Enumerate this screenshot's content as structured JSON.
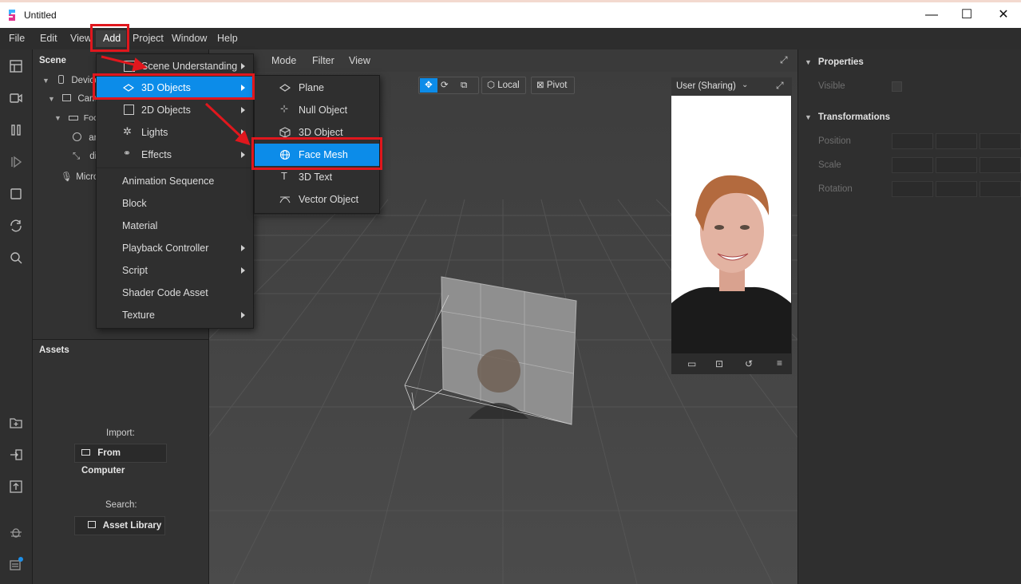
{
  "window": {
    "title": "Untitled",
    "minimize": "—",
    "maximize": "☐",
    "close": "✕"
  },
  "menubar": {
    "items": [
      "File",
      "Edit",
      "View",
      "Add",
      "Project",
      "Window",
      "Help"
    ],
    "active": "Add"
  },
  "scene": {
    "title": "Scene",
    "tree": [
      {
        "label": "Device"
      },
      {
        "label": "Came"
      },
      {
        "label": "Foca"
      },
      {
        "label": "an"
      },
      {
        "label": "di"
      },
      {
        "label": "Micro"
      }
    ]
  },
  "assets": {
    "title": "Assets",
    "import_label": "Import:",
    "import_button": "From Computer",
    "search_label": "Search:",
    "search_button": "Asset Library"
  },
  "viewport": {
    "menu": [
      "t",
      "Mode",
      "Filter",
      "View"
    ],
    "tools": {
      "local": "Local",
      "pivot": "Pivot"
    }
  },
  "preview": {
    "device_label": "User (Sharing)"
  },
  "properties": {
    "section1": "Properties",
    "visible_label": "Visible",
    "section2": "Transformations",
    "rows": [
      "Position",
      "Scale",
      "Rotation"
    ]
  },
  "add_menu": {
    "items": [
      {
        "label": "Scene Understanding",
        "has_submenu": true,
        "icon": "scene-icon"
      },
      {
        "label": "3D Objects",
        "has_submenu": true,
        "icon": "plane-icon",
        "highlighted": true
      },
      {
        "label": "2D Objects",
        "has_submenu": true,
        "icon": "rect-icon"
      },
      {
        "label": "Lights",
        "has_submenu": true,
        "icon": "sun-icon"
      },
      {
        "label": "Effects",
        "has_submenu": true,
        "icon": "effects-icon"
      },
      {
        "label": "Animation Sequence",
        "has_submenu": false
      },
      {
        "label": "Block",
        "has_submenu": false
      },
      {
        "label": "Material",
        "has_submenu": false
      },
      {
        "label": "Playback Controller",
        "has_submenu": true
      },
      {
        "label": "Script",
        "has_submenu": true
      },
      {
        "label": "Shader Code Asset",
        "has_submenu": false
      },
      {
        "label": "Texture",
        "has_submenu": true
      }
    ]
  },
  "objects_submenu": {
    "items": [
      {
        "label": "Plane",
        "icon": "plane-icon"
      },
      {
        "label": "Null Object",
        "icon": "null-object-icon"
      },
      {
        "label": "3D Object",
        "icon": "cube-icon"
      },
      {
        "label": "Face Mesh",
        "icon": "globe-icon",
        "highlighted": true
      },
      {
        "label": "3D Text",
        "icon": "text-icon"
      },
      {
        "label": "Vector Object",
        "icon": "vector-icon"
      }
    ]
  },
  "colors": {
    "highlight": "#0c8ce9",
    "annotation_red": "#e0171d"
  }
}
